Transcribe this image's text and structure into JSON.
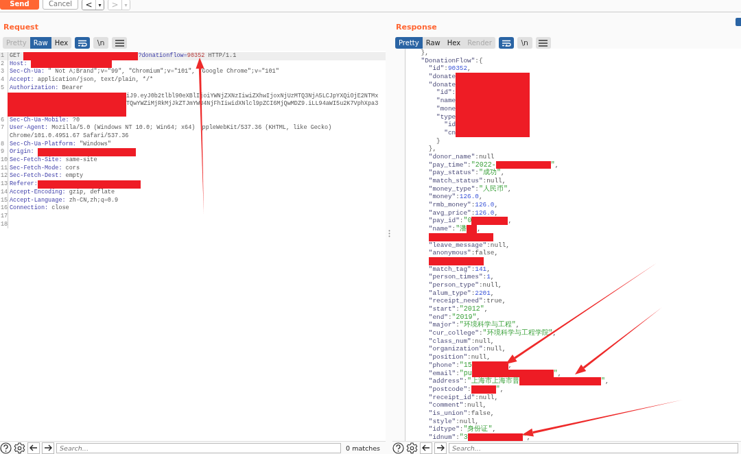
{
  "toolbar": {
    "buttons": [
      {
        "label": "Send",
        "kind": "primary"
      },
      {
        "label": "Cancel",
        "kind": "plain"
      }
    ],
    "nav": [
      {
        "label": "<",
        "menu": "▾",
        "disabled": false
      },
      {
        "label": ">",
        "menu": "▾",
        "disabled": true
      }
    ]
  },
  "request": {
    "title": "Request",
    "tabs": [
      {
        "label": "Pretty",
        "selected": false,
        "disabled": true
      },
      {
        "label": "Raw",
        "selected": true,
        "disabled": false
      },
      {
        "label": "Hex",
        "selected": false,
        "disabled": false
      }
    ],
    "tools": [
      {
        "kind": "wrap",
        "on": true
      },
      {
        "kind": "newline",
        "label": "\\n",
        "on": false
      },
      {
        "kind": "menu",
        "on": false
      }
    ],
    "lines": [
      {
        "num": "1",
        "highlighted": true,
        "rows": [
          {
            "parts": [
              {
                "kind": "plain",
                "text": "GET "
              },
              {
                "kind": "redacted"
              },
              {
                "kind": "param",
                "text": "?donationflow="
              },
              {
                "kind": "number",
                "text": "90352"
              },
              {
                "kind": "plain",
                "text": " HTTP/1.1"
              }
            ]
          }
        ]
      },
      {
        "num": "2",
        "highlighted": false,
        "rows": [
          {
            "parts": [
              {
                "kind": "header",
                "text": "Host:"
              },
              {
                "kind": "redacted"
              }
            ]
          }
        ]
      },
      {
        "num": "3",
        "highlighted": false,
        "rows": [
          {
            "parts": [
              {
                "kind": "header",
                "text": "Sec-Ch-Ua:"
              },
              {
                "kind": "plain",
                "text": " \" Not A;Brand\";v=\"99\", \"Chromium\";v=\"101\", \"Google Chrome\";v=\"101\""
              }
            ]
          }
        ]
      },
      {
        "num": "4",
        "highlighted": false,
        "rows": [
          {
            "parts": [
              {
                "kind": "header",
                "text": "Accept:"
              },
              {
                "kind": "plain",
                "text": " application/json, text/plain, */*"
              }
            ]
          }
        ]
      },
      {
        "num": "5",
        "highlighted": false,
        "rows": [
          {
            "parts": [
              {
                "kind": "header",
                "text": "Authorization:"
              },
              {
                "kind": "plain",
                "text": " Bearer"
              }
            ]
          },
          {
            "parts": [
              {
                "kind": "redacted"
              },
              {
                "kind": "plain",
                "text": "iJ9.eyJ0b2tlbl90eXBlIjoiYWNjZXNzIiwiZXhwIjoxNjUzMTQ3NjA5LCJpYXQiOjE2NTMx"
              }
            ]
          },
          {
            "parts": [
              {
                "kind": "redacted"
              },
              {
                "kind": "plain",
                "text": "TQwYWZiMjRkMjJkZTJmYWU4NjFhIiwidXNlcl9pZCI6MjQwMDZ9.iLL94aWI5u2K7VphXpa3"
              }
            ]
          },
          {
            "parts": [
              {
                "kind": "redacted"
              }
            ]
          }
        ]
      },
      {
        "num": "6",
        "highlighted": false,
        "rows": [
          {
            "parts": [
              {
                "kind": "header",
                "text": "Sec-Ch-Ua-Mobile:"
              },
              {
                "kind": "plain",
                "text": " ?0"
              }
            ]
          }
        ]
      },
      {
        "num": "7",
        "highlighted": false,
        "rows": [
          {
            "parts": [
              {
                "kind": "header",
                "text": "User-Agent:"
              },
              {
                "kind": "plain",
                "text": " Mozilla/5.0 (Windows NT 10.0; Win64; x64)"
              },
              {
                "kind": "plain",
                "text": "ppleWebKit/537.36 (KHTML, like Gecko)"
              }
            ]
          },
          {
            "parts": [
              {
                "kind": "plain",
                "text": "Chrome/101.0.4951.67 Safari/537.36"
              }
            ]
          }
        ]
      },
      {
        "num": "8",
        "highlighted": false,
        "rows": [
          {
            "parts": [
              {
                "kind": "header",
                "text": "Sec-Ch-Ua-Platform:"
              },
              {
                "kind": "plain",
                "text": " \"Windows\""
              }
            ]
          }
        ]
      },
      {
        "num": "9",
        "highlighted": false,
        "rows": [
          {
            "parts": [
              {
                "kind": "header",
                "text": "Origin:"
              },
              {
                "kind": "redacted"
              }
            ]
          }
        ]
      },
      {
        "num": "10",
        "highlighted": false,
        "rows": [
          {
            "parts": [
              {
                "kind": "header",
                "text": "Sec-Fetch-Site:"
              },
              {
                "kind": "plain",
                "text": " same-site"
              }
            ]
          }
        ]
      },
      {
        "num": "11",
        "highlighted": false,
        "rows": [
          {
            "parts": [
              {
                "kind": "header",
                "text": "Sec-Fetch-Mode:"
              },
              {
                "kind": "plain",
                "text": " cors"
              }
            ]
          }
        ]
      },
      {
        "num": "12",
        "highlighted": false,
        "rows": [
          {
            "parts": [
              {
                "kind": "header",
                "text": "Sec-Fetch-Dest:"
              },
              {
                "kind": "plain",
                "text": " empty"
              }
            ]
          }
        ]
      },
      {
        "num": "13",
        "highlighted": false,
        "rows": [
          {
            "parts": [
              {
                "kind": "header",
                "text": "Referer:"
              },
              {
                "kind": "redacted"
              }
            ]
          }
        ]
      },
      {
        "num": "14",
        "highlighted": false,
        "rows": [
          {
            "parts": [
              {
                "kind": "header",
                "text": "Accept-Encoding:"
              },
              {
                "kind": "plain",
                "text": " gzip, deflate"
              }
            ]
          }
        ]
      },
      {
        "num": "15",
        "highlighted": false,
        "rows": [
          {
            "parts": [
              {
                "kind": "header",
                "text": "Accept-Language:"
              },
              {
                "kind": "plain",
                "text": " zh-CN,zh;q=0.9"
              }
            ]
          }
        ]
      },
      {
        "num": "16",
        "highlighted": false,
        "rows": [
          {
            "parts": [
              {
                "kind": "header",
                "text": "Connection:"
              },
              {
                "kind": "plain",
                "text": " close"
              }
            ]
          }
        ]
      },
      {
        "num": "17",
        "highlighted": false
      },
      {
        "num": "18",
        "highlighted": false
      }
    ],
    "search": {
      "placeholder": "Search..."
    },
    "matches": "0 matches"
  },
  "response": {
    "title": "Response",
    "tabs": [
      {
        "label": "Pretty",
        "selected": true,
        "disabled": false
      },
      {
        "label": "Raw",
        "selected": false,
        "disabled": false
      },
      {
        "label": "Hex",
        "selected": false,
        "disabled": false
      },
      {
        "label": "Render",
        "selected": false,
        "disabled": true
      }
    ],
    "tools": [
      {
        "kind": "wrap",
        "on": true
      },
      {
        "kind": "newline",
        "label": "\\n",
        "on": false
      },
      {
        "kind": "menu",
        "on": false
      }
    ],
    "rows": [
      {
        "parts": [
          {
            "kind": "plain",
            "text": "    },"
          }
        ]
      },
      {
        "parts": [
          {
            "kind": "key",
            "text": "    \"DonationFlow\""
          },
          {
            "kind": "plain",
            "text": ":{"
          }
        ]
      },
      {
        "parts": [
          {
            "kind": "key",
            "text": "      \"id\""
          },
          {
            "kind": "plain",
            "text": ":"
          },
          {
            "kind": "number",
            "text": "90352"
          },
          {
            "kind": "plain",
            "text": ","
          }
        ]
      },
      {
        "parts": [
          {
            "kind": "key",
            "text": "      \"donate"
          },
          {
            "kind": "redacted"
          }
        ]
      },
      {
        "parts": [
          {
            "kind": "key",
            "text": "      \"donate"
          },
          {
            "kind": "redacted"
          }
        ]
      },
      {
        "parts": [
          {
            "kind": "key",
            "text": "        \"id\":"
          },
          {
            "kind": "redacted"
          }
        ]
      },
      {
        "parts": [
          {
            "kind": "key",
            "text": "        \"name"
          },
          {
            "kind": "redacted"
          }
        ]
      },
      {
        "parts": [
          {
            "kind": "key",
            "text": "        \"mone"
          },
          {
            "kind": "redacted"
          }
        ]
      },
      {
        "parts": [
          {
            "kind": "key",
            "text": "        \"type"
          },
          {
            "kind": "redacted"
          }
        ]
      },
      {
        "parts": [
          {
            "kind": "key",
            "text": "          \"id"
          },
          {
            "kind": "redacted"
          }
        ]
      },
      {
        "parts": [
          {
            "kind": "key",
            "text": "          \"cn"
          },
          {
            "kind": "redacted"
          }
        ]
      },
      {
        "parts": [
          {
            "kind": "plain",
            "text": "        }"
          }
        ]
      },
      {
        "parts": [
          {
            "kind": "plain",
            "text": "      },"
          }
        ]
      },
      {
        "parts": [
          {
            "kind": "key",
            "text": "      \"donor_name\""
          },
          {
            "kind": "plain",
            "text": ":"
          },
          {
            "kind": "literal",
            "text": "null"
          }
        ]
      },
      {
        "parts": [
          {
            "kind": "key",
            "text": "      \"pay_time\""
          },
          {
            "kind": "plain",
            "text": ":"
          },
          {
            "kind": "string",
            "text": "\"2022-"
          },
          {
            "kind": "redacted"
          },
          {
            "kind": "string",
            "text": "\""
          },
          {
            "kind": "plain",
            "text": ","
          }
        ]
      },
      {
        "parts": [
          {
            "kind": "key",
            "text": "      \"pay_status\""
          },
          {
            "kind": "plain",
            "text": ":"
          },
          {
            "kind": "string",
            "text": "\"成功\""
          },
          {
            "kind": "plain",
            "text": ","
          }
        ]
      },
      {
        "parts": [
          {
            "kind": "key",
            "text": "      \"match_status\""
          },
          {
            "kind": "plain",
            "text": ":"
          },
          {
            "kind": "literal",
            "text": "null"
          },
          {
            "kind": "plain",
            "text": ","
          }
        ]
      },
      {
        "parts": [
          {
            "kind": "key",
            "text": "      \"money_type\""
          },
          {
            "kind": "plain",
            "text": ":"
          },
          {
            "kind": "string",
            "text": "\"人民币\""
          },
          {
            "kind": "plain",
            "text": ","
          }
        ]
      },
      {
        "parts": [
          {
            "kind": "key",
            "text": "      \"money\""
          },
          {
            "kind": "plain",
            "text": ":"
          },
          {
            "kind": "number",
            "text": "126.0"
          },
          {
            "kind": "plain",
            "text": ","
          }
        ]
      },
      {
        "parts": [
          {
            "kind": "key",
            "text": "      \"rmb_money\""
          },
          {
            "kind": "plain",
            "text": ":"
          },
          {
            "kind": "number",
            "text": "126.0"
          },
          {
            "kind": "plain",
            "text": ","
          }
        ]
      },
      {
        "parts": [
          {
            "kind": "key",
            "text": "      \"avg_price\""
          },
          {
            "kind": "plain",
            "text": ":"
          },
          {
            "kind": "number",
            "text": "126.0"
          },
          {
            "kind": "plain",
            "text": ","
          }
        ]
      },
      {
        "parts": [
          {
            "kind": "key",
            "text": "      \"pay_id\""
          },
          {
            "kind": "plain",
            "text": ":"
          },
          {
            "kind": "string",
            "text": "\"0"
          },
          {
            "kind": "redacted"
          },
          {
            "kind": "plain",
            "text": ","
          }
        ]
      },
      {
        "parts": [
          {
            "kind": "key",
            "text": "      \"name\""
          },
          {
            "kind": "plain",
            "text": ":"
          },
          {
            "kind": "string",
            "text": "\"潘"
          },
          {
            "kind": "redacted"
          },
          {
            "kind": "plain",
            "text": ","
          }
        ]
      },
      {
        "parts": [
          {
            "kind": "redacted"
          }
        ]
      },
      {
        "parts": [
          {
            "kind": "key",
            "text": "      \"leave_message\""
          },
          {
            "kind": "plain",
            "text": ":"
          },
          {
            "kind": "literal",
            "text": "null"
          },
          {
            "kind": "plain",
            "text": ","
          }
        ]
      },
      {
        "parts": [
          {
            "kind": "key",
            "text": "      \"anonymous\""
          },
          {
            "kind": "plain",
            "text": ":"
          },
          {
            "kind": "literal",
            "text": "false"
          },
          {
            "kind": "plain",
            "text": ","
          }
        ]
      },
      {
        "parts": [
          {
            "kind": "redacted"
          }
        ]
      },
      {
        "parts": [
          {
            "kind": "key",
            "text": "      \"match_tag\""
          },
          {
            "kind": "plain",
            "text": ":"
          },
          {
            "kind": "number",
            "text": "141"
          },
          {
            "kind": "plain",
            "text": ","
          }
        ]
      },
      {
        "parts": [
          {
            "kind": "key",
            "text": "      \"person_times\""
          },
          {
            "kind": "plain",
            "text": ":"
          },
          {
            "kind": "number",
            "text": "1"
          },
          {
            "kind": "plain",
            "text": ","
          }
        ]
      },
      {
        "parts": [
          {
            "kind": "key",
            "text": "      \"person_type\""
          },
          {
            "kind": "plain",
            "text": ":"
          },
          {
            "kind": "literal",
            "text": "null"
          },
          {
            "kind": "plain",
            "text": ","
          }
        ]
      },
      {
        "parts": [
          {
            "kind": "key",
            "text": "      \"alum_type\""
          },
          {
            "kind": "plain",
            "text": ":"
          },
          {
            "kind": "number",
            "text": "2201"
          },
          {
            "kind": "plain",
            "text": ","
          }
        ]
      },
      {
        "parts": [
          {
            "kind": "key",
            "text": "      \"receipt_need\""
          },
          {
            "kind": "plain",
            "text": ":"
          },
          {
            "kind": "literal",
            "text": "true"
          },
          {
            "kind": "plain",
            "text": ","
          }
        ]
      },
      {
        "parts": [
          {
            "kind": "key",
            "text": "      \"start\""
          },
          {
            "kind": "plain",
            "text": ":"
          },
          {
            "kind": "string",
            "text": "\"2012\""
          },
          {
            "kind": "plain",
            "text": ","
          }
        ]
      },
      {
        "parts": [
          {
            "kind": "key",
            "text": "      \"end\""
          },
          {
            "kind": "plain",
            "text": ":"
          },
          {
            "kind": "string",
            "text": "\"2019\""
          },
          {
            "kind": "plain",
            "text": ","
          }
        ]
      },
      {
        "parts": [
          {
            "kind": "key",
            "text": "      \"major\""
          },
          {
            "kind": "plain",
            "text": ":"
          },
          {
            "kind": "string",
            "text": "\"环境科学与工程\""
          },
          {
            "kind": "plain",
            "text": ","
          }
        ]
      },
      {
        "parts": [
          {
            "kind": "key",
            "text": "      \"cur_college\""
          },
          {
            "kind": "plain",
            "text": ":"
          },
          {
            "kind": "string",
            "text": "\"环境科学与工程学院\""
          },
          {
            "kind": "plain",
            "text": ","
          }
        ]
      },
      {
        "parts": [
          {
            "kind": "key",
            "text": "      \"class_num\""
          },
          {
            "kind": "plain",
            "text": ":"
          },
          {
            "kind": "literal",
            "text": "null"
          },
          {
            "kind": "plain",
            "text": ","
          }
        ]
      },
      {
        "parts": [
          {
            "kind": "key",
            "text": "      \"organization\""
          },
          {
            "kind": "plain",
            "text": ":"
          },
          {
            "kind": "literal",
            "text": "null"
          },
          {
            "kind": "plain",
            "text": ","
          }
        ]
      },
      {
        "parts": [
          {
            "kind": "key",
            "text": "      \"position\""
          },
          {
            "kind": "plain",
            "text": ":"
          },
          {
            "kind": "literal",
            "text": "null"
          },
          {
            "kind": "plain",
            "text": ","
          }
        ]
      },
      {
        "parts": [
          {
            "kind": "key",
            "text": "      \"phone\""
          },
          {
            "kind": "plain",
            "text": ":"
          },
          {
            "kind": "string",
            "text": "\"15"
          },
          {
            "kind": "redacted"
          },
          {
            "kind": "plain",
            "text": ","
          }
        ]
      },
      {
        "parts": [
          {
            "kind": "key",
            "text": "      \"email\""
          },
          {
            "kind": "plain",
            "text": ":"
          },
          {
            "kind": "string",
            "text": "\"pu"
          },
          {
            "kind": "redacted"
          },
          {
            "kind": "string",
            "text": "\""
          },
          {
            "kind": "plain",
            "text": ","
          }
        ]
      },
      {
        "parts": [
          {
            "kind": "key",
            "text": "      \"address\""
          },
          {
            "kind": "plain",
            "text": ":"
          },
          {
            "kind": "string",
            "text": "\"上海市上海市普"
          },
          {
            "kind": "redacted"
          },
          {
            "kind": "string",
            "text": "\""
          },
          {
            "kind": "plain",
            "text": ","
          }
        ]
      },
      {
        "parts": [
          {
            "kind": "key",
            "text": "      \"postcode\""
          },
          {
            "kind": "plain",
            "text": ":"
          },
          {
            "kind": "redacted"
          },
          {
            "kind": "string",
            "text": "\""
          },
          {
            "kind": "plain",
            "text": ","
          }
        ]
      },
      {
        "parts": [
          {
            "kind": "key",
            "text": "      \"receipt_id\""
          },
          {
            "kind": "plain",
            "text": ":"
          },
          {
            "kind": "literal",
            "text": "null"
          },
          {
            "kind": "plain",
            "text": ","
          }
        ]
      },
      {
        "parts": [
          {
            "kind": "key",
            "text": "      \"comment\""
          },
          {
            "kind": "plain",
            "text": ":"
          },
          {
            "kind": "literal",
            "text": "null"
          },
          {
            "kind": "plain",
            "text": ","
          }
        ]
      },
      {
        "parts": [
          {
            "kind": "key",
            "text": "      \"is_union\""
          },
          {
            "kind": "plain",
            "text": ":"
          },
          {
            "kind": "literal",
            "text": "false"
          },
          {
            "kind": "plain",
            "text": ","
          }
        ]
      },
      {
        "parts": [
          {
            "kind": "key",
            "text": "      \"style\""
          },
          {
            "kind": "plain",
            "text": ":"
          },
          {
            "kind": "literal",
            "text": "null"
          },
          {
            "kind": "plain",
            "text": ","
          }
        ]
      },
      {
        "parts": [
          {
            "kind": "key",
            "text": "      \"idtype\""
          },
          {
            "kind": "plain",
            "text": ":"
          },
          {
            "kind": "string",
            "text": "\"身份证\""
          },
          {
            "kind": "plain",
            "text": ","
          }
        ]
      },
      {
        "parts": [
          {
            "kind": "key",
            "text": "      \"idnum\""
          },
          {
            "kind": "plain",
            "text": ":"
          },
          {
            "kind": "string",
            "text": "\"3"
          },
          {
            "kind": "redacted"
          },
          {
            "kind": "string",
            "text": "\""
          },
          {
            "kind": "plain",
            "text": ","
          }
        ]
      }
    ],
    "search": {
      "placeholder": "Search..."
    }
  }
}
